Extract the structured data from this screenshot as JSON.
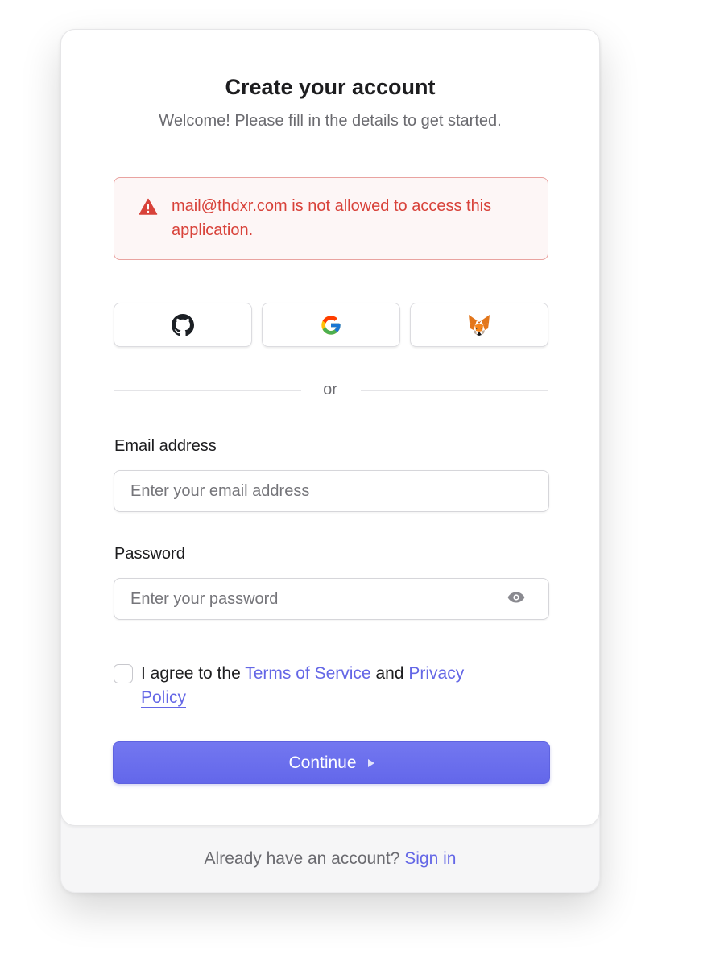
{
  "header": {
    "title": "Create your account",
    "subtitle": "Welcome! Please fill in the details to get started."
  },
  "alert": {
    "message": "mail@thdxr.com is not allowed to access this application.",
    "icon": "warning-triangle-icon",
    "color": "#d8423a"
  },
  "social": [
    {
      "provider": "GitHub",
      "icon": "github-icon"
    },
    {
      "provider": "Google",
      "icon": "google-icon"
    },
    {
      "provider": "MetaMask",
      "icon": "metamask-fox-icon"
    }
  ],
  "divider": {
    "label": "or"
  },
  "form": {
    "email": {
      "label": "Email address",
      "placeholder": "Enter your email address",
      "value": ""
    },
    "password": {
      "label": "Password",
      "placeholder": "Enter your password",
      "value": ""
    },
    "agree": {
      "prefix": "I agree to the",
      "terms_link": "Terms of Service",
      "conjunction": "and",
      "privacy_link": "Privacy Policy",
      "checked": false
    },
    "continue_label": "Continue"
  },
  "footer": {
    "prompt": "Already have an account?",
    "signin_label": "Sign in"
  },
  "colors": {
    "accent": "#6467e6",
    "error": "#d8423a"
  }
}
